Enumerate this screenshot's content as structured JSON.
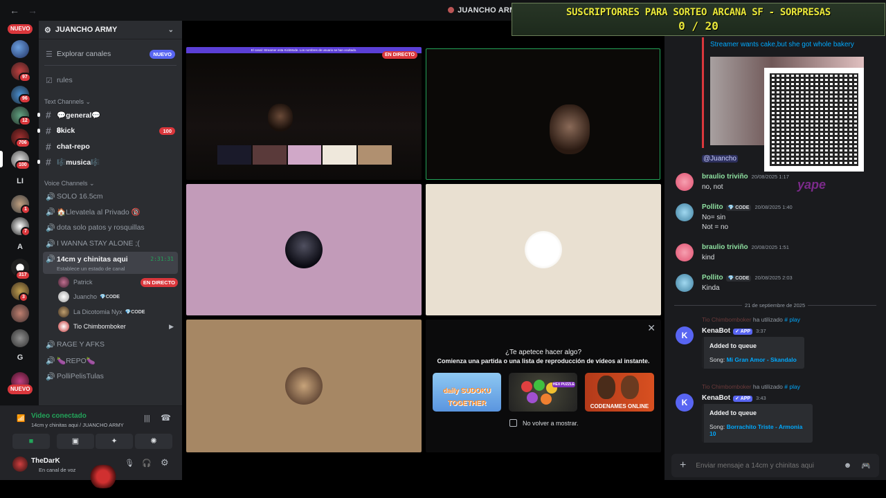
{
  "app": {
    "title": "JUANCHO ARMY"
  },
  "banner": {
    "line1": "SUSCRIPTORRES PARA SORTEO ARCANA SF - SORPRESAS",
    "line2": "0 / 20"
  },
  "rail": {
    "new_top": "NUEVO",
    "new_bottom": "NUEVO",
    "badges": [
      "97",
      "96",
      "12",
      "706",
      "100",
      "1",
      "7",
      "317",
      "3"
    ],
    "letters": [
      "LI",
      "A",
      "G"
    ]
  },
  "server": {
    "name": "JUANCHO ARMY"
  },
  "sidebar": {
    "explore": "Explorar canales",
    "explore_badge": "NUEVO",
    "rules": "rules",
    "text_category": "Text Channels",
    "text_channels": [
      {
        "name": "💬general💬",
        "badge": ""
      },
      {
        "name": "𝟖kick",
        "badge": "100"
      },
      {
        "name": "chat-repo",
        "badge": ""
      },
      {
        "name": "🎼musica🎼",
        "badge": ""
      }
    ],
    "voice_category": "Voice Channels",
    "voice_channels_top": [
      "SOLO 16.5cm",
      "🏠Llevatela al Privado 🔞",
      "dota solo patos y rosquillas",
      "I WANNA STAY ALONE ;("
    ],
    "active_voice": {
      "name": "14cm y chinitas aqui",
      "timer": "2:31:31",
      "status": "Establece un estado de canal"
    },
    "members": [
      {
        "name": "Patrick",
        "tag": "",
        "live": "EN DIRECTO"
      },
      {
        "name": "Juancho",
        "tag": "CODE",
        "live": ""
      },
      {
        "name": "La Dicotomia Nyx",
        "tag": "CODE",
        "live": ""
      },
      {
        "name": "Tio Chimbomboker",
        "tag": "",
        "live": ""
      }
    ],
    "voice_channels_bottom": [
      "RAGE Y AFKS",
      "🍆REPO🍆",
      "PolliPelisTulas"
    ]
  },
  "voice_panel": {
    "status": "Video conectado",
    "location": "14cm y chinitas aqui / JUANCHO ARMY"
  },
  "user_panel": {
    "name": "TheDarK",
    "status": "En canal de voz"
  },
  "stage": {
    "stream_badge": "EN DIRECTO",
    "stream_topbar": "El canal: Streamer esta KickMode. Los nombres de usuario se han ocultado.",
    "activity": {
      "title": "¿Te apetece hacer algo?",
      "subtitle": "Comienza una partida o una lista de reproducción de vídeos al instante.",
      "games": [
        "daily SUDOKU TOGETHER",
        "HEX PUZZLE",
        "CODENAMES ONLINE"
      ],
      "dont_show": "No volver a mostrar."
    }
  },
  "chat": {
    "embed_link": "Streamer wants cake,but she got whole bakery",
    "mention": "@Juancho",
    "messages": [
      {
        "author": "braulio triviño",
        "time": "20/08/2025 1:17",
        "text": [
          "no, not"
        ],
        "tag": ""
      },
      {
        "author": "Pollito",
        "time": "20/08/2025 1:40",
        "text": [
          "No= sin",
          "Not = no"
        ],
        "tag": "CODE"
      },
      {
        "author": "braulio triviño",
        "time": "20/08/2025 1:51",
        "text": [
          "kind"
        ],
        "tag": ""
      },
      {
        "author": "Pollito",
        "time": "20/08/2025 2:03",
        "text": [
          "Kinda"
        ],
        "tag": "CODE"
      }
    ],
    "date_divider": "21 de septiembre de 2025",
    "bot_msgs": [
      {
        "reply_user": "Tio Chimbomboker",
        "reply_verb": "ha utilizado",
        "reply_cmd": "play",
        "author": "KenaBot",
        "tag": "APP",
        "time": "3:37",
        "embed_title": "Added to queue",
        "song_label": "Song:",
        "song": "Mi Gran Amor - Skandalo"
      },
      {
        "reply_user": "Tio Chimbomboker",
        "reply_verb": "ha utilizado",
        "reply_cmd": "play",
        "author": "KenaBot",
        "tag": "APP",
        "time": "3:43",
        "embed_title": "Added to queue",
        "song_label": "Song:",
        "song": "Borrachito Triste - Armonia 10"
      }
    ],
    "yape": "yape",
    "composer_placeholder": "Enviar mensaje a 14cm y chinitas aqui"
  },
  "colors": {
    "accent": "#5865f2",
    "live": "#da373c",
    "green": "#23a55a",
    "banner_text": "#e9e83a"
  }
}
